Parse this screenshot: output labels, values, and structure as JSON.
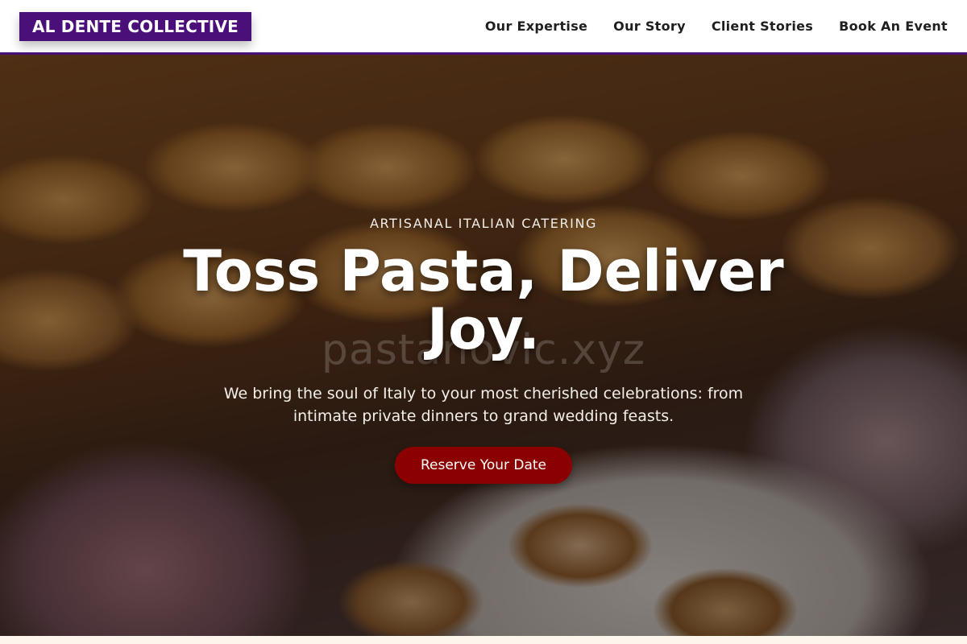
{
  "header": {
    "logo": "AL DENTE COLLECTIVE",
    "nav": [
      {
        "label": "Our Expertise"
      },
      {
        "label": "Our Story"
      },
      {
        "label": "Client Stories"
      },
      {
        "label": "Book An Event"
      }
    ]
  },
  "hero": {
    "eyebrow": "ARTISANAL ITALIAN CATERING",
    "headline": "Toss Pasta, Deliver Joy.",
    "watermark": "pastanovic.xyz",
    "subcopy": "We bring the soul of Italy to your most cherished celebrations: from intimate private dinners to grand wedding feasts.",
    "cta_label": "Reserve Your Date"
  },
  "colors": {
    "brand": "#4b0f7a",
    "cta": "#8b0000"
  }
}
